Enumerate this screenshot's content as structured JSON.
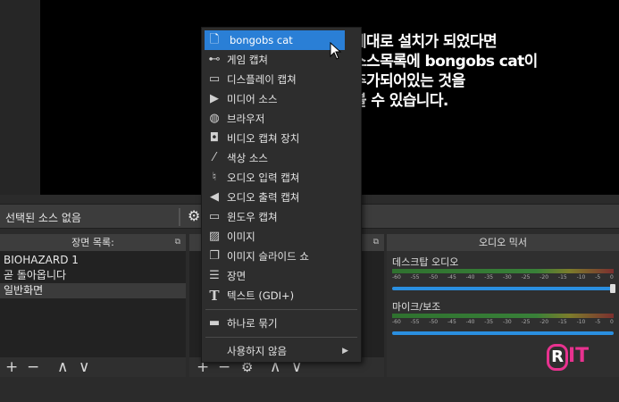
{
  "overlay": {
    "line1": "제대로 설치가 되었다면",
    "line2": "소스목록에 bongobs cat이",
    "line3": "추가되어있는 것을",
    "line4": "볼 수 있습니다."
  },
  "properties_bar": {
    "label": "선택된 소스 없음"
  },
  "scenes": {
    "title": "장면 목록:",
    "items": [
      {
        "label": "BIOHAZARD 1"
      },
      {
        "label": "곧 돌아옵니다"
      },
      {
        "label": "일반화면"
      }
    ],
    "footer": {
      "add": "+",
      "remove": "−",
      "up": "∧",
      "down": "∨"
    }
  },
  "sources": {
    "footer": {
      "add": "+",
      "remove": "−",
      "gear": "⚙",
      "up": "∧",
      "down": "∨"
    }
  },
  "mixer": {
    "title": "오디오 믹서",
    "channels": [
      {
        "name": "데스크탑 오디오",
        "level": 1.0
      },
      {
        "name": "마이크/보조",
        "level": 1.0
      }
    ],
    "ticks": [
      "-60",
      "-55",
      "-50",
      "-45",
      "-40",
      "-35",
      "-30",
      "-25",
      "-20",
      "-15",
      "-10",
      "-5",
      "0"
    ]
  },
  "menu": {
    "items": [
      {
        "label": "bongobs cat",
        "icon": "file-icon",
        "glyph": "🗋"
      },
      {
        "label": "게임 캡쳐",
        "icon": "gamepad-icon",
        "glyph": "⊷"
      },
      {
        "label": "디스플레이 캡쳐",
        "icon": "monitor-icon",
        "glyph": "▭"
      },
      {
        "label": "미디어 소스",
        "icon": "play-icon",
        "glyph": "▶"
      },
      {
        "label": "브라우저",
        "icon": "globe-icon",
        "glyph": "◍"
      },
      {
        "label": "비디오 캡쳐 장치",
        "icon": "camera-icon",
        "glyph": "◘"
      },
      {
        "label": "색상 소스",
        "icon": "brush-icon",
        "glyph": "⁄"
      },
      {
        "label": "오디오 입력 캡쳐",
        "icon": "microphone-icon",
        "glyph": "♮"
      },
      {
        "label": "오디오 출력 캡쳐",
        "icon": "speaker-icon",
        "glyph": "◀"
      },
      {
        "label": "윈도우 캡쳐",
        "icon": "window-icon",
        "glyph": "▭"
      },
      {
        "label": "이미지",
        "icon": "image-icon",
        "glyph": "▨"
      },
      {
        "label": "이미지 슬라이드 쇼",
        "icon": "slideshow-icon",
        "glyph": "❐"
      },
      {
        "label": "장면",
        "icon": "list-icon",
        "glyph": "☰"
      },
      {
        "label": "텍스트 (GDI+)",
        "icon": "text-icon",
        "glyph": "T"
      }
    ],
    "group": {
      "label": "하나로 묶기",
      "icon": "folder-icon",
      "glyph": "▬"
    },
    "deprecated": {
      "label": "사용하지 않음",
      "arrow": "▶"
    }
  },
  "watermark": {
    "letter": "R",
    "text": "IT"
  }
}
